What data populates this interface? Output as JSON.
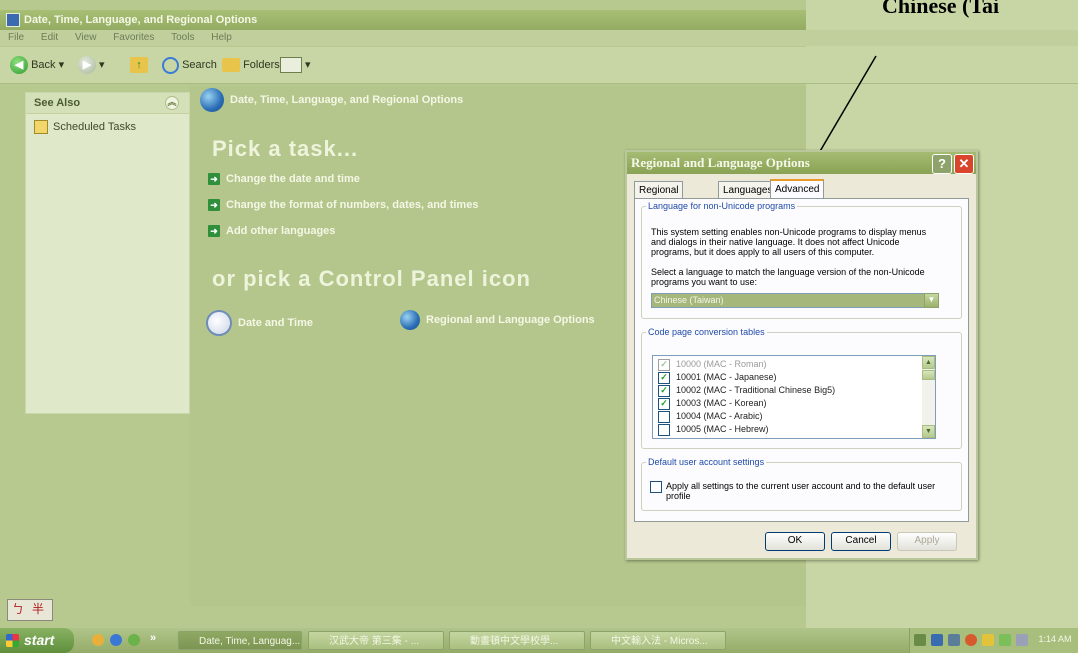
{
  "window": {
    "title": "Date, Time, Language, and Regional Options"
  },
  "menu": [
    "File",
    "Edit",
    "View",
    "Favorites",
    "Tools",
    "Help"
  ],
  "toolbar": {
    "back": "Back",
    "search": "Search",
    "folders": "Folders"
  },
  "sidebar": {
    "title": "See Also",
    "items": [
      {
        "label": "Scheduled Tasks"
      }
    ]
  },
  "content": {
    "header": "Date, Time, Language, and Regional Options",
    "pick_task": "Pick a task...",
    "tasks": [
      "Change the date and time",
      "Change the format of numbers, dates, and times",
      "Add other languages"
    ],
    "or_pick": "or pick a Control Panel icon",
    "icons": [
      "Date and Time",
      "Regional and Language Options"
    ]
  },
  "dialog": {
    "title": "Regional and Language Options",
    "tabs": [
      "Regional Options",
      "Languages",
      "Advanced"
    ],
    "active_tab": "Advanced",
    "nonunicode": {
      "legend": "Language for non-Unicode programs",
      "desc": "This system setting enables non-Unicode programs to display menus and dialogs in their native language. It does not affect Unicode programs, but it does apply to all users of this computer.",
      "select_label": "Select a language to match the language version of the non-Unicode programs you want to use:",
      "selected": "Chinese (Taiwan)"
    },
    "codepages": {
      "legend": "Code page conversion tables",
      "items": [
        {
          "label": "10000 (MAC - Roman)",
          "checked": true,
          "grayed": true
        },
        {
          "label": "10001 (MAC - Japanese)",
          "checked": true,
          "grayed": false
        },
        {
          "label": "10002 (MAC - Traditional Chinese Big5)",
          "checked": true,
          "grayed": false
        },
        {
          "label": "10003 (MAC - Korean)",
          "checked": true,
          "grayed": false
        },
        {
          "label": "10004 (MAC - Arabic)",
          "checked": false,
          "grayed": false
        },
        {
          "label": "10005 (MAC - Hebrew)",
          "checked": false,
          "grayed": false
        }
      ]
    },
    "default_user": {
      "legend": "Default user account settings",
      "checkbox_label": "Apply all settings to the current user account and to the default user profile"
    },
    "buttons": {
      "ok": "OK",
      "cancel": "Cancel",
      "apply": "Apply"
    }
  },
  "overlay_text": "Chinese (Tai",
  "ime": {
    "a": "ㄅ",
    "b": "半"
  },
  "taskbar": {
    "start": "start",
    "buttons": [
      "Date, Time, Languag...",
      "汉武大帝 第三集 - ...",
      "動畫頓中文學校學...",
      "中文輸入法 - Micros..."
    ],
    "clock": "1:14 AM"
  }
}
